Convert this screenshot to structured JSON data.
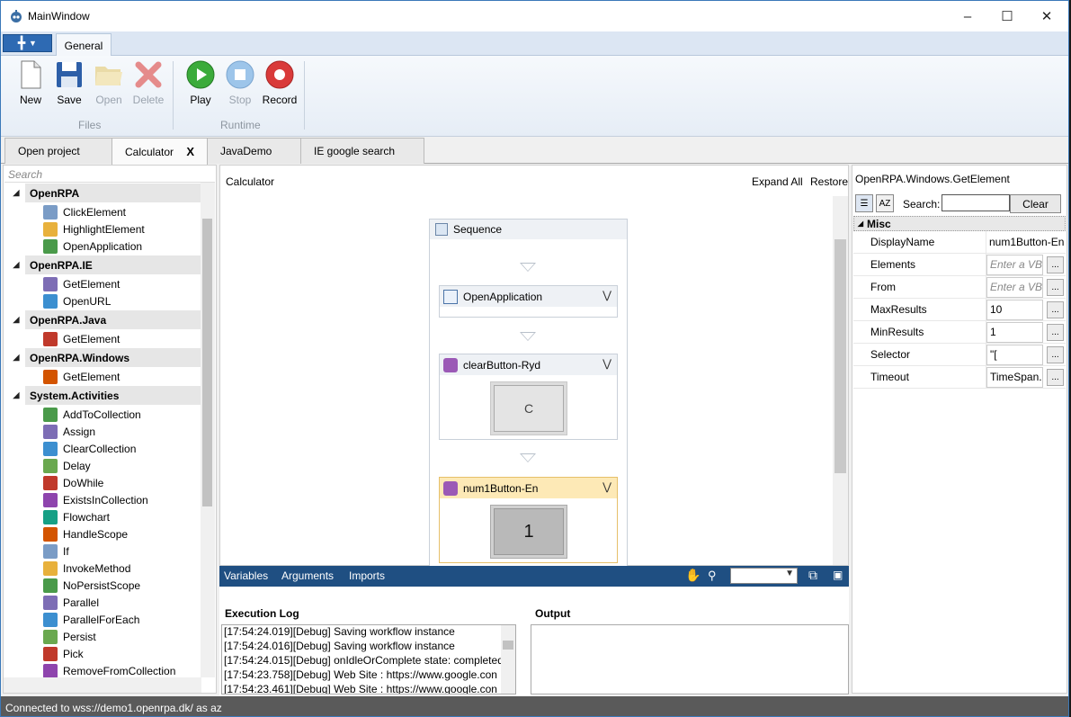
{
  "window": {
    "title": "MainWindow",
    "minimize_icon": "minimize-icon",
    "maximize_icon": "maximize-icon",
    "close_icon": "close-icon"
  },
  "ribbon": {
    "tabs": [
      {
        "label": "General"
      }
    ],
    "buttons": {
      "new": "New",
      "save": "Save",
      "open": "Open",
      "delete": "Delete",
      "play": "Play",
      "stop": "Stop",
      "record": "Record"
    },
    "groups": {
      "files": "Files",
      "runtime": "Runtime"
    }
  },
  "doc_tabs": [
    {
      "label": "Open project"
    },
    {
      "label": "Calculator",
      "close": "X"
    },
    {
      "label": "JavaDemo"
    },
    {
      "label": "IE google search"
    }
  ],
  "toolbox": {
    "search_placeholder": "Search",
    "categories": [
      {
        "name": "OpenRPA",
        "items": [
          "ClickElement",
          "HighlightElement",
          "OpenApplication"
        ]
      },
      {
        "name": "OpenRPA.IE",
        "items": [
          "GetElement",
          "OpenURL"
        ]
      },
      {
        "name": "OpenRPA.Java",
        "items": [
          "GetElement"
        ]
      },
      {
        "name": "OpenRPA.Windows",
        "items": [
          "GetElement"
        ]
      },
      {
        "name": "System.Activities",
        "items": [
          "AddToCollection",
          "Assign",
          "ClearCollection",
          "Delay",
          "DoWhile",
          "ExistsInCollection",
          "Flowchart",
          "HandleScope",
          "If",
          "InvokeMethod",
          "NoPersistScope",
          "Parallel",
          "ParallelForEach",
          "Persist",
          "Pick",
          "RemoveFromCollection"
        ]
      }
    ]
  },
  "designer": {
    "breadcrumb": "Calculator",
    "expand_all": "Expand All",
    "restore": "Restore",
    "sequence": "Sequence",
    "activities": [
      {
        "title": "OpenApplication",
        "preview": ""
      },
      {
        "title": "clearButton-Ryd",
        "preview": "C"
      },
      {
        "title": "num1Button-En",
        "preview": "1"
      }
    ]
  },
  "varbar": {
    "variables": "Variables",
    "arguments": "Arguments",
    "imports": "Imports",
    "zoom_value": ""
  },
  "log": {
    "title": "Execution Log",
    "lines": [
      "[17:54:24.019][Debug] Saving workflow instance",
      "[17:54:24.016][Debug] Saving workflow instance",
      "[17:54:24.015][Debug] onIdleOrComplete state: completed",
      "[17:54:23.758][Debug] Web Site   : https://www.google.con",
      "[17:54:23.461][Debug] Web Site   : https://www.google.con"
    ]
  },
  "output": {
    "title": "Output"
  },
  "properties": {
    "title": "OpenRPA.Windows.GetElement",
    "search_label": "Search:",
    "clear": "Clear",
    "category": "Misc",
    "rows": [
      {
        "name": "DisplayName",
        "value": "num1Button-En",
        "placeholder": false,
        "dots": false
      },
      {
        "name": "Elements",
        "value": "Enter a VB",
        "placeholder": true,
        "dots": true
      },
      {
        "name": "From",
        "value": "Enter a VB",
        "placeholder": true,
        "dots": true
      },
      {
        "name": "MaxResults",
        "value": "10",
        "placeholder": false,
        "dots": true
      },
      {
        "name": "MinResults",
        "value": "1",
        "placeholder": false,
        "dots": true
      },
      {
        "name": "Selector",
        "value": "\"[",
        "placeholder": false,
        "dots": true
      },
      {
        "name": "Timeout",
        "value": "TimeSpan.",
        "placeholder": false,
        "dots": true
      }
    ]
  },
  "status": "Connected to wss://demo1.openrpa.dk/ as az"
}
